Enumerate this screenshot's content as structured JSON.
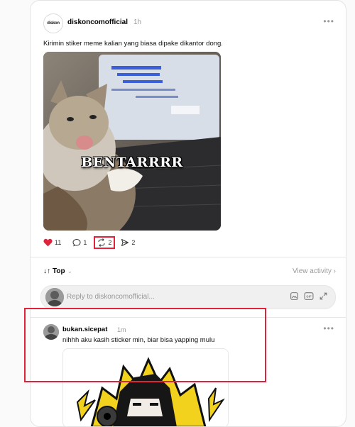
{
  "post": {
    "username": "diskoncomofficial",
    "time": "1h",
    "caption": "Kirimin stiker meme kalian yang biasa dipake dikantor dong.",
    "avatar_text": "diskon",
    "image_overlay_text": "BENTARRRR",
    "stats": {
      "likes": "11",
      "comments": "1",
      "reposts": "2",
      "shares": "2"
    }
  },
  "thread": {
    "sort_label": "Top",
    "view_activity": "View activity",
    "reply_placeholder": "Reply to diskoncomofficial..."
  },
  "comment": {
    "username": "bukan.sicepat",
    "time": "1m",
    "text": "nihhh aku kasih sticker min, biar bisa yapping mulu"
  },
  "colors": {
    "like": "#e0223a",
    "highlight": "#e0223a",
    "muted": "#999999"
  }
}
